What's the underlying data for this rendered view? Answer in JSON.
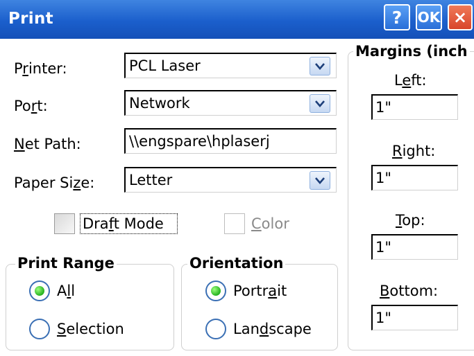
{
  "window": {
    "title": "Print",
    "help_label": "?",
    "ok_label": "OK",
    "close_label": "×"
  },
  "printer": {
    "label_pre": "P",
    "label_ul": "r",
    "label_post": "inter:",
    "value": "PCL Laser"
  },
  "port": {
    "label_pre": "Po",
    "label_ul": "r",
    "label_post": "t:",
    "value": "Network"
  },
  "net_path": {
    "label_pre": "",
    "label_ul": "N",
    "label_post": "et Path:",
    "value": "\\\\engspare\\hplaserj"
  },
  "paper_size": {
    "label_pre": "Paper Si",
    "label_ul": "z",
    "label_post": "e:",
    "value": "Letter"
  },
  "draft_mode": {
    "label_pre": "Dra",
    "label_ul": "f",
    "label_post": "t Mode",
    "checked": false
  },
  "color": {
    "label_pre": "",
    "label_ul": "C",
    "label_post": "olor",
    "checked": false,
    "enabled": false
  },
  "print_range": {
    "title": "Print Range",
    "options": [
      {
        "pre": "A",
        "ul": "l",
        "post": "l",
        "selected": true
      },
      {
        "pre": "",
        "ul": "S",
        "post": "election",
        "selected": false
      }
    ]
  },
  "orientation": {
    "title": "Orientation",
    "options": [
      {
        "pre": "Portr",
        "ul": "a",
        "post": "it",
        "selected": true
      },
      {
        "pre": "Lan",
        "ul": "d",
        "post": "scape",
        "selected": false
      }
    ]
  },
  "margins": {
    "title": "Margins (inch",
    "left": {
      "label_pre": "L",
      "label_ul": "e",
      "label_post": "ft:",
      "value": "1\""
    },
    "right": {
      "label_pre": "",
      "label_ul": "R",
      "label_post": "ight:",
      "value": "1\""
    },
    "top": {
      "label_pre": "",
      "label_ul": "T",
      "label_post": "op:",
      "value": "1\""
    },
    "bottom": {
      "label_pre": "",
      "label_ul": "B",
      "label_post": "ottom:",
      "value": "1\""
    }
  },
  "colors": {
    "titlebar": "#1b5fcc",
    "close_button": "#d8452a",
    "radio_selected": "#25b11f"
  },
  "icons": {
    "dropdown": "chevron-down-icon"
  }
}
